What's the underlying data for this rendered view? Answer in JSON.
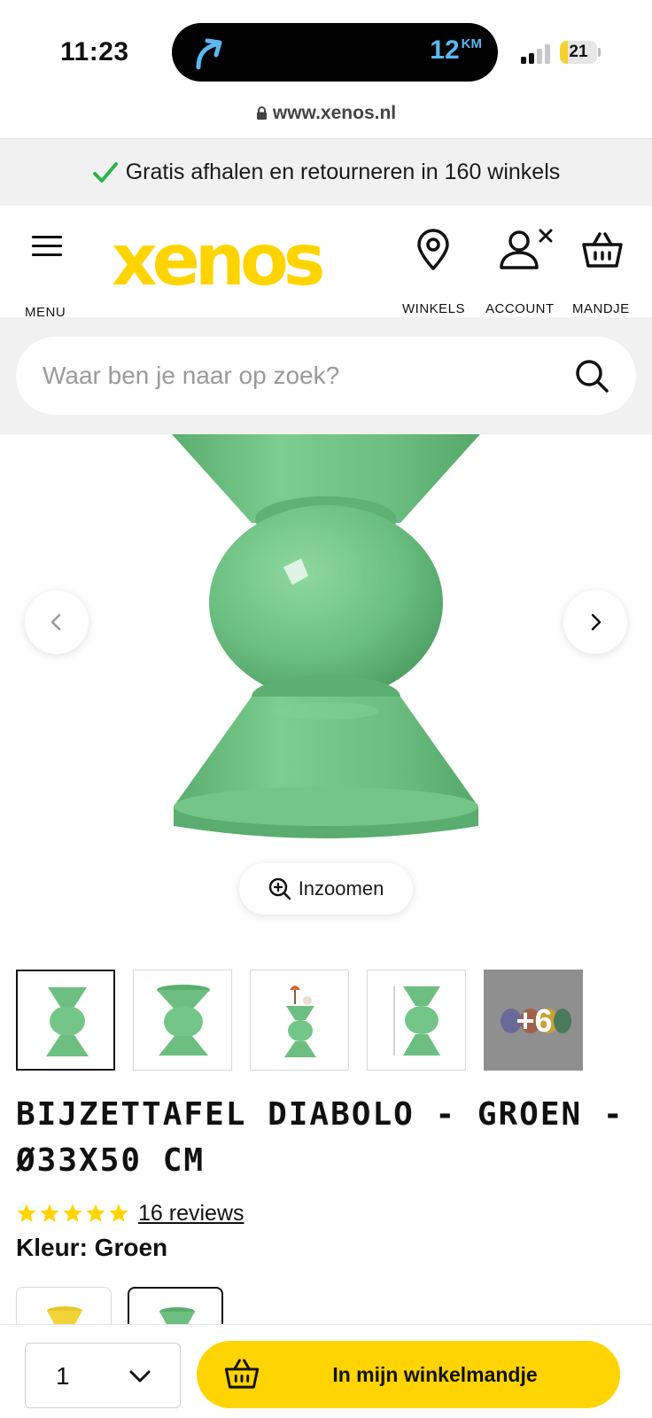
{
  "status_bar": {
    "time": "11:23",
    "navigation_distance": "12",
    "navigation_unit": "KM",
    "battery": "21",
    "battery_level": 0.21,
    "icons": [
      "navigation-arrow-icon",
      "signal-icon",
      "battery-icon"
    ]
  },
  "browser": {
    "url": "www.xenos.nl"
  },
  "promo": {
    "text": "Gratis afhalen en retourneren in 160 winkels",
    "icon": "check-icon",
    "icon_color": "#2db34a"
  },
  "header": {
    "menu_label": "MENU",
    "logo_text": "xenos",
    "logo_color": "#ffd400",
    "stores_label": "WINKELS",
    "account_label": "ACCOUNT",
    "cart_label": "MANDJE"
  },
  "search": {
    "placeholder": "Waar ben je naar op zoek?"
  },
  "gallery": {
    "zoom_label": "Inzoomen",
    "more_images_label": "+6",
    "product_color": "#6fc383"
  },
  "product": {
    "title": "BIJZETTAFEL DIABOLO - GROEN - Ø33X50 CM",
    "rating": 5,
    "reviews_label": "16 reviews",
    "color_label": "Kleur: Groen",
    "star_color": "#ffd400"
  },
  "purchase": {
    "quantity": "1",
    "add_to_cart_label": "In mijn winkelmandje",
    "button_color": "#ffd400"
  }
}
